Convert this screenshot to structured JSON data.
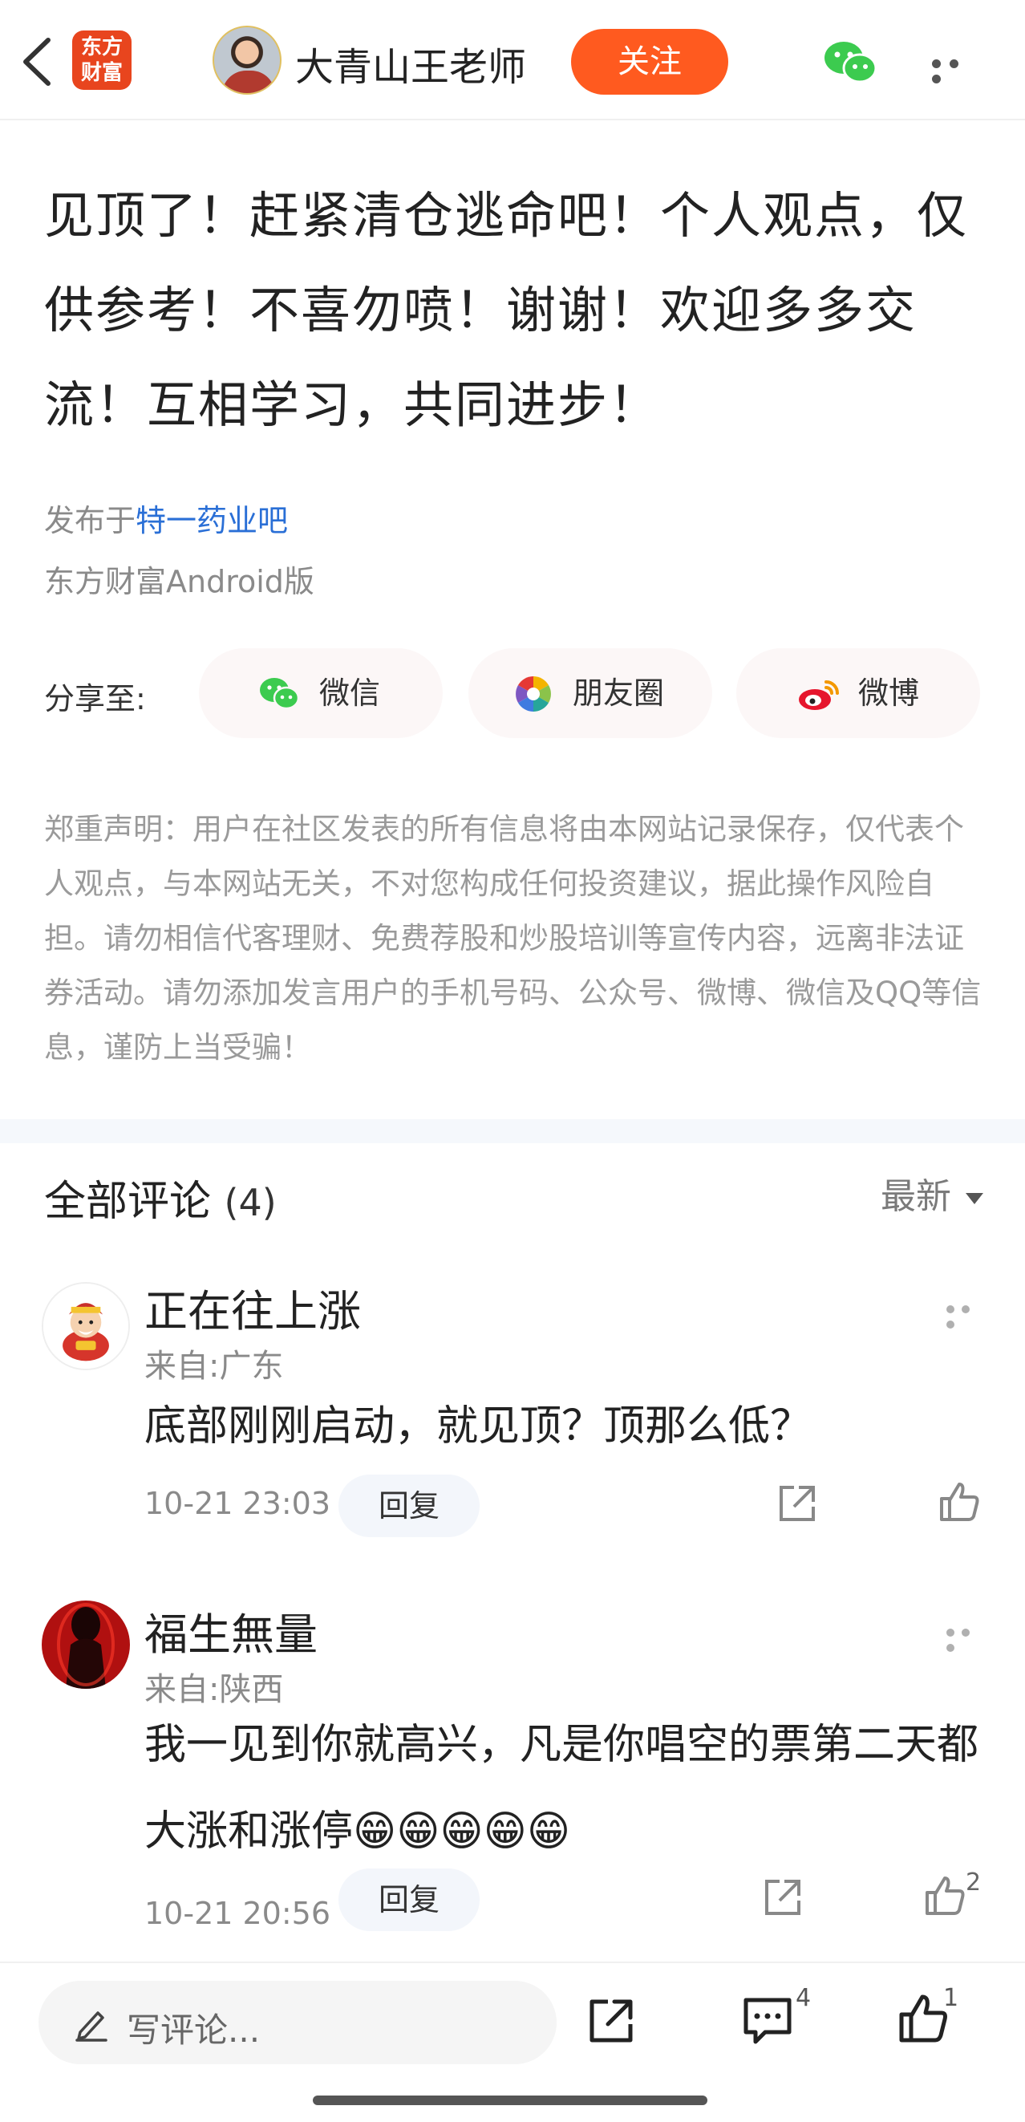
{
  "header": {
    "app_logo_text": "东方财富",
    "author_name": "大青山王老师",
    "follow_label": "关注"
  },
  "post": {
    "title": "见顶了！赶紧清仓逃命吧！个人观点，仅供参考！不喜勿喷！谢谢！欢迎多多交流！互相学习，共同进步！",
    "published_prefix": "发布于",
    "forum_link": "特一药业吧",
    "client": "东方财富Android版"
  },
  "share": {
    "label": "分享至:",
    "buttons": [
      {
        "label": "微信",
        "icon": "wechat-icon"
      },
      {
        "label": "朋友圈",
        "icon": "moments-icon"
      },
      {
        "label": "微博",
        "icon": "weibo-icon"
      }
    ]
  },
  "disclaimer": "郑重声明：用户在社区发表的所有信息将由本网站记录保存，仅代表个人观点，与本网站无关，不对您构成任何投资建议，据此操作风险自担。请勿相信代客理财、免费荐股和炒股培训等宣传内容，远离非法证券活动。请勿添加发言用户的手机号码、公众号、微博、微信及QQ等信息，谨防上当受骗！",
  "comments_section": {
    "title": "全部评论",
    "count": "(4)",
    "sort_label": "最新"
  },
  "comments": [
    {
      "name": "正在往上涨",
      "from": "来自:广东",
      "text": "底部刚刚启动，就见顶？顶那么低？",
      "time": "10-21 23:03",
      "reply_label": "回复",
      "likes": ""
    },
    {
      "name": "福生無量",
      "from": "来自:陕西",
      "text": "我一见到你就高兴，凡是你唱空的票第二天都大涨和涨停😁😁😁😁😁",
      "time": "10-21 20:56",
      "reply_label": "回复",
      "likes": "2"
    }
  ],
  "bottom_bar": {
    "comment_placeholder": "写评论...",
    "comment_count": "4",
    "like_count": "1"
  },
  "colors": {
    "accent": "#ff5a1f",
    "link": "#2a6fd6",
    "brand": "#e8451e"
  }
}
